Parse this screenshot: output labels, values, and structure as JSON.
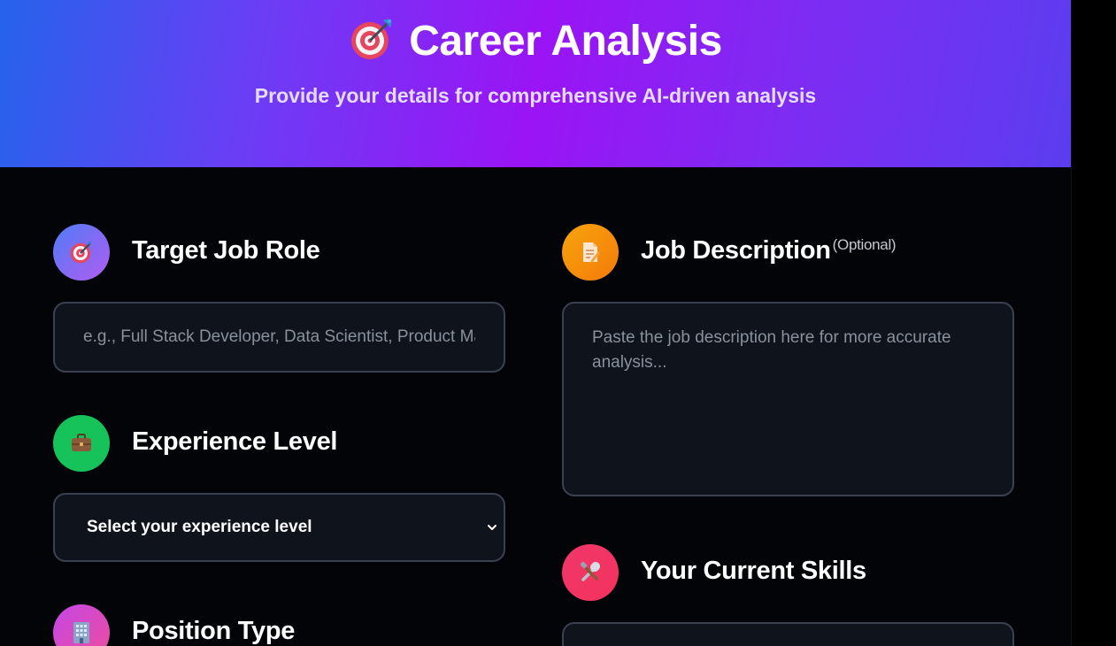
{
  "hero": {
    "icon": "target-dart-icon",
    "title": "Career Analysis",
    "subtitle": "Provide your details for comprehensive AI-driven analysis"
  },
  "left_column": {
    "job_role": {
      "icon": "target-dart-icon",
      "label": "Target Job Role",
      "placeholder": "e.g., Full Stack Developer, Data Scientist, Product Manager"
    },
    "experience": {
      "icon": "briefcase-icon",
      "label": "Experience Level",
      "selected": "Select your experience level"
    },
    "position": {
      "icon": "office-building-icon",
      "label": "Position Type"
    }
  },
  "right_column": {
    "job_description": {
      "icon": "document-pencil-icon",
      "label": "Job Description",
      "optional": "(Optional)",
      "placeholder": "Paste the job description here for more accurate analysis..."
    },
    "skills": {
      "icon": "tools-icon",
      "label": "Your Current Skills"
    }
  },
  "colors": {
    "hero_gradient": [
      "#2563eb",
      "#9a14f5",
      "#5b3df0"
    ],
    "job_role_icon_bg": [
      "#4f7cf7",
      "#b15cf0"
    ],
    "experience_icon_bg": "#16c35a",
    "position_icon_bg": [
      "#c447e6",
      "#ee4d9b"
    ],
    "job_description_icon_bg": [
      "#f8a50d",
      "#f47a0a"
    ],
    "skills_icon_bg": [
      "#f0386a",
      "#f4315d"
    ]
  }
}
